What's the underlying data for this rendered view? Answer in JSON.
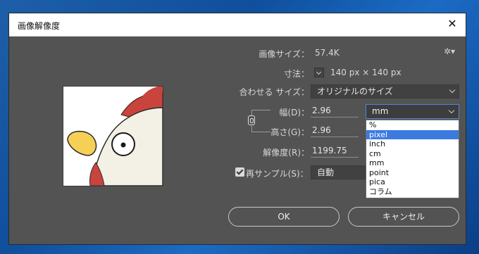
{
  "window": {
    "title": "画像解像度",
    "close_symbol": "✕"
  },
  "image_size": {
    "label": "画像サイズ：",
    "value": "57.4K"
  },
  "dimensions": {
    "label": "寸法：",
    "value": "140 px × 140 px"
  },
  "fit_to": {
    "label": "合わせる サイズ：",
    "selected": "オリジナルのサイズ"
  },
  "width": {
    "label": "幅(D)：",
    "value": "2.96"
  },
  "height": {
    "label": "高さ(G)：",
    "value": "2.96"
  },
  "resolution": {
    "label": "解像度(R)：",
    "value": "1199.75"
  },
  "resample": {
    "label": "再サンプル(S)：",
    "checked": true,
    "selected": "自動"
  },
  "unit_select": {
    "selected": "mm"
  },
  "unit_options": [
    "%",
    "pixel",
    "inch",
    "cm",
    "mm",
    "point",
    "pica",
    "コラム"
  ],
  "unit_highlighted": "pixel",
  "buttons": {
    "ok": "OK",
    "cancel": "キャンセル"
  },
  "icons": {
    "gear": "gear-icon",
    "link": "link-icon",
    "close": "close-icon"
  },
  "colors": {
    "dialog_bg": "#535353",
    "accent": "#3b7be0",
    "preview_bg": "#ffffff"
  }
}
